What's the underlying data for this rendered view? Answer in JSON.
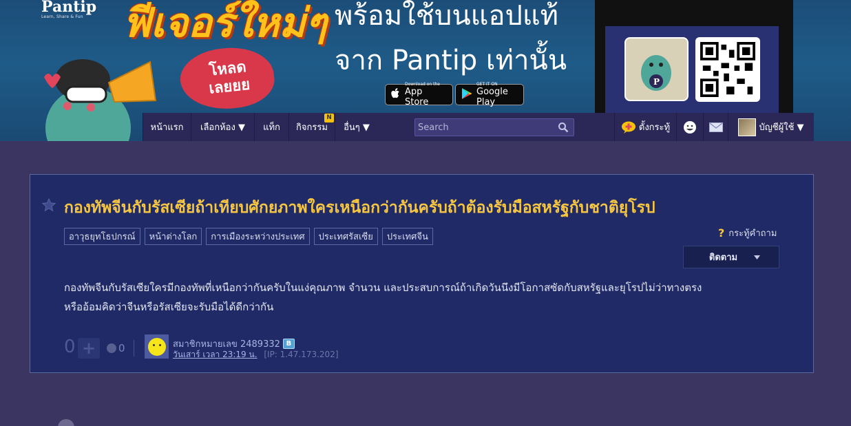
{
  "banner": {
    "brand": "Pantip",
    "tagline": "Learn, Share & Fun",
    "feature_heading": "ฟีเจอร์ใหม่ๆ",
    "download_bubble": "โหลดเลยยย",
    "promo_line1": "พร้อมใช้บนแอปแท้",
    "promo_line2": "จาก Pantip เท่านั้น",
    "appstore_small": "Download on the",
    "appstore_big": "App Store",
    "googleplay_small": "GET IT ON",
    "googleplay_big": "Google Play"
  },
  "nav": {
    "home": "หน้าแรก",
    "rooms": "เลือกห้อง ▼",
    "tags": "แท็ก",
    "activities": "กิจกรรม",
    "activities_badge": "N",
    "more": "อื่นๆ ▼",
    "search_placeholder": "Search",
    "new_topic": "ตั้งกระทู้",
    "account": "บัญชีผู้ใช้ ▼"
  },
  "topic": {
    "title": "กองทัพจีนกับรัสเซียถ้าเทียบศักยภาพใครเหนือกว่ากันครับถ้าต้องรับมือสหรัฐกับชาติยุโรป",
    "tags": [
      "อาวุธยุทโธปกรณ์",
      "หน้าต่างโลก",
      "การเมืองระหว่างประเทศ",
      "ประเทศรัสเซีย",
      "ประเทศจีน"
    ],
    "type_label": "กระทู้คำถาม",
    "follow_label": "ติดตาม",
    "body_line1": "กองทัพจีนกับรัสเซียใครมีกองทัพที่เหนือกว่ากันครับในแง่คุณภาพ  จำนวน  และประสบการณ์ถ้าเกิดวันนึงมีโอกาสซัดกับสหรัฐและยุโรปไม่ว่าทางตรง",
    "body_line2": "หรืออ้อมคิดว่าจีนหรือรัสเซียจะรับมือได้ดีกว่ากัน",
    "vote_count": "0",
    "plus_symbol": "+",
    "emotion_count": "0",
    "author": "สมาชิกหมายเลข 2489332",
    "member_badge": "B",
    "post_time": "วันเสาร์ เวลา 23:19 น.",
    "ip": "[IP: 1.47.173.202]"
  },
  "colors": {
    "page_bg": "#3b3561",
    "card_bg": "#1f2a66",
    "title": "#f6c643",
    "nav_bg": "#2b2756"
  }
}
